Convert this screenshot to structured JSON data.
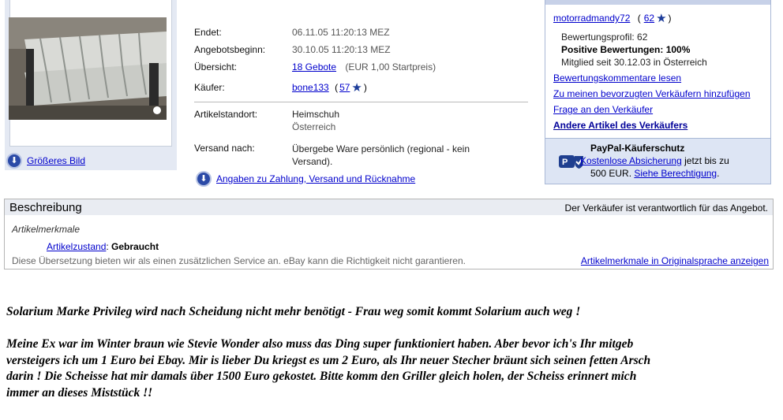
{
  "image_panel": {
    "bigger_image_label": "Größeres Bild"
  },
  "details": {
    "ended_label": "Endet:",
    "ended_value": "06.11.05 11:20:13 MEZ",
    "start_label": "Angebotsbeginn:",
    "start_value": "30.10.05 11:20:13 MEZ",
    "overview_label": "Übersicht:",
    "bids_link": "18 Gebote",
    "start_price": "(EUR 1,00 Startpreis)",
    "buyer_label": "Käufer:",
    "buyer_name": "bone133",
    "buyer_score": "57",
    "location_label": "Artikelstandort:",
    "location_city": "Heimschuh",
    "location_country": "Österreich",
    "shipping_label": "Versand nach:",
    "shipping_value": "Übergebe Ware persönlich (regional - kein Versand).",
    "payment_link": "Angaben zu Zahlung, Versand und Rücknahme"
  },
  "seller": {
    "name": "motorradmandy72",
    "score": "62",
    "profile_line": "Bewertungsprofil: 62",
    "positive_line": "Positive Bewertungen: 100%",
    "member_line": "Mitglied seit 30.12.03 in Österreich",
    "links": [
      "Bewertungskommentare lesen",
      "Zu meinen bevorzugten Verkäufern hinzufügen",
      "Frage an den Verkäufer",
      "Andere Artikel des Verkäufers"
    ]
  },
  "paypal": {
    "title": "PayPal-Käuferschutz",
    "free_link": "Kostenlose Absicherung",
    "text1": " jetzt bis zu",
    "text2": "500 EUR. ",
    "eligibility_link": "Siehe Berechtigung",
    "text3": "."
  },
  "description": {
    "title": "Beschreibung",
    "responsibility": "Der Verkäufer ist verantwortlich für das Angebot.",
    "attributes_heading": "Artikelmerkmale",
    "condition_label": "Artikelzustand",
    "condition_sep": ": ",
    "condition_value": "Gebraucht",
    "disclaimer": "Diese Übersetzung bieten wir als einen zusätzlichen Service an. eBay kann die Richtigkeit nicht garantieren.",
    "original_link": "Artikelmerkmale in Originalsprache anzeigen"
  },
  "story": {
    "para1": "Solarium Marke Privileg wird nach Scheidung nicht mehr benötigt - Frau weg somit kommt Solarium auch weg !",
    "para2_line1": "Meine Ex war im Winter braun wie Stevie Wonder also muss das Ding super funktioniert haben. Aber bevor ich's Ihr mitgeb",
    "para2_line2": "versteigers ich um 1 Euro bei Ebay. Mir is lieber Du kriegst es um 2 Euro, als Ihr neuer Stecher bräunt sich seinen fetten Arsch",
    "para2_line3": "darin ! Die Scheisse hat mir damals über 1500 Euro gekostet. Bitte komm den Griller gleich holen, der Scheiss erinnert mich",
    "para2_line4": "immer an dieses Miststück !!"
  }
}
